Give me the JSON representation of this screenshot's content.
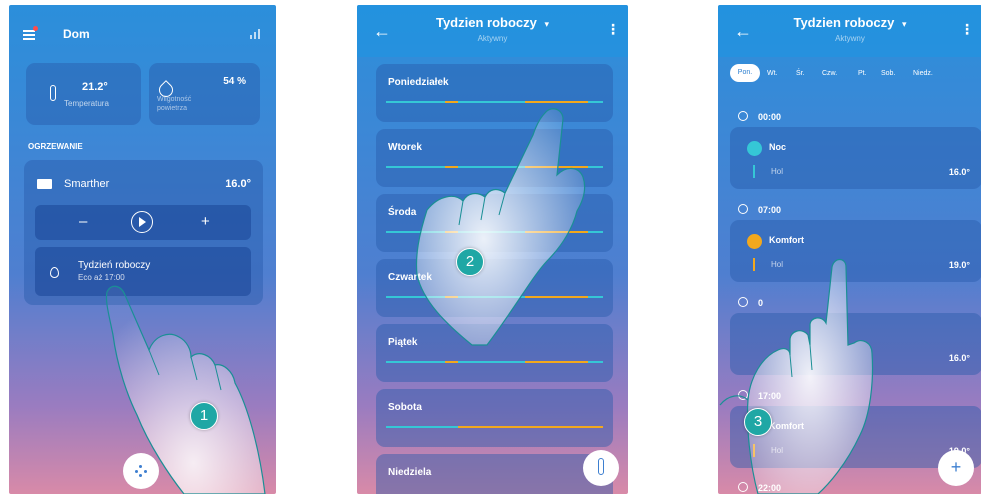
{
  "screen1": {
    "title": "Dom",
    "temp_value": "21.2°",
    "temp_label": "Temperatura",
    "hum_value": "54 %",
    "hum_label": "Wilgotność powietrza",
    "section": "OGRZEWANIE",
    "device": "Smarther",
    "device_temp": "16.0°",
    "minus": "–",
    "plus": "+",
    "program": "Tydzień roboczy",
    "program_sub": "Eco aż 17:00",
    "step": "1"
  },
  "screen2": {
    "title": "Tydzien roboczy",
    "subtitle": "Aktywny",
    "days": [
      {
        "name": "Poniedziałek",
        "segments": [
          [
            0.27,
            0.33
          ],
          [
            0.64,
            0.93
          ]
        ]
      },
      {
        "name": "Wtorek",
        "segments": [
          [
            0.27,
            0.33
          ],
          [
            0.64,
            0.93
          ]
        ]
      },
      {
        "name": "Środa",
        "segments": [
          [
            0.27,
            0.33
          ],
          [
            0.64,
            0.93
          ]
        ]
      },
      {
        "name": "Czwartek",
        "segments": [
          [
            0.27,
            0.33
          ],
          [
            0.64,
            0.93
          ]
        ]
      },
      {
        "name": "Piątek",
        "segments": [
          [
            0.27,
            0.33
          ],
          [
            0.64,
            0.93
          ]
        ]
      },
      {
        "name": "Sobota",
        "segments": [
          [
            0.33,
            1.0
          ]
        ]
      },
      {
        "name": "Niedziela",
        "segments": []
      }
    ],
    "step": "2"
  },
  "screen3": {
    "title": "Tydzien roboczy",
    "subtitle": "Aktywny",
    "days": [
      "Pon.",
      "Wt.",
      "Śr.",
      "Czw.",
      "Pt.",
      "Sob.",
      "Niedz."
    ],
    "t1": "00:00",
    "mode1": "Noc",
    "room1": "Hol",
    "temp1": "16.0°",
    "t2": "07:00",
    "mode2": "Komfort",
    "room2": "Hol",
    "temp2": "19.0°",
    "t3": "0",
    "temp3": "16.0°",
    "t4": "17:00",
    "mode4": "Komfort",
    "room4": "Hol",
    "temp4": "19.0°",
    "t5": "22:00",
    "plus": "+",
    "step": "3"
  },
  "colors": {
    "comfort": "#f2a81d",
    "eco": "#35c7d6",
    "badge": "#1fa7a5"
  }
}
